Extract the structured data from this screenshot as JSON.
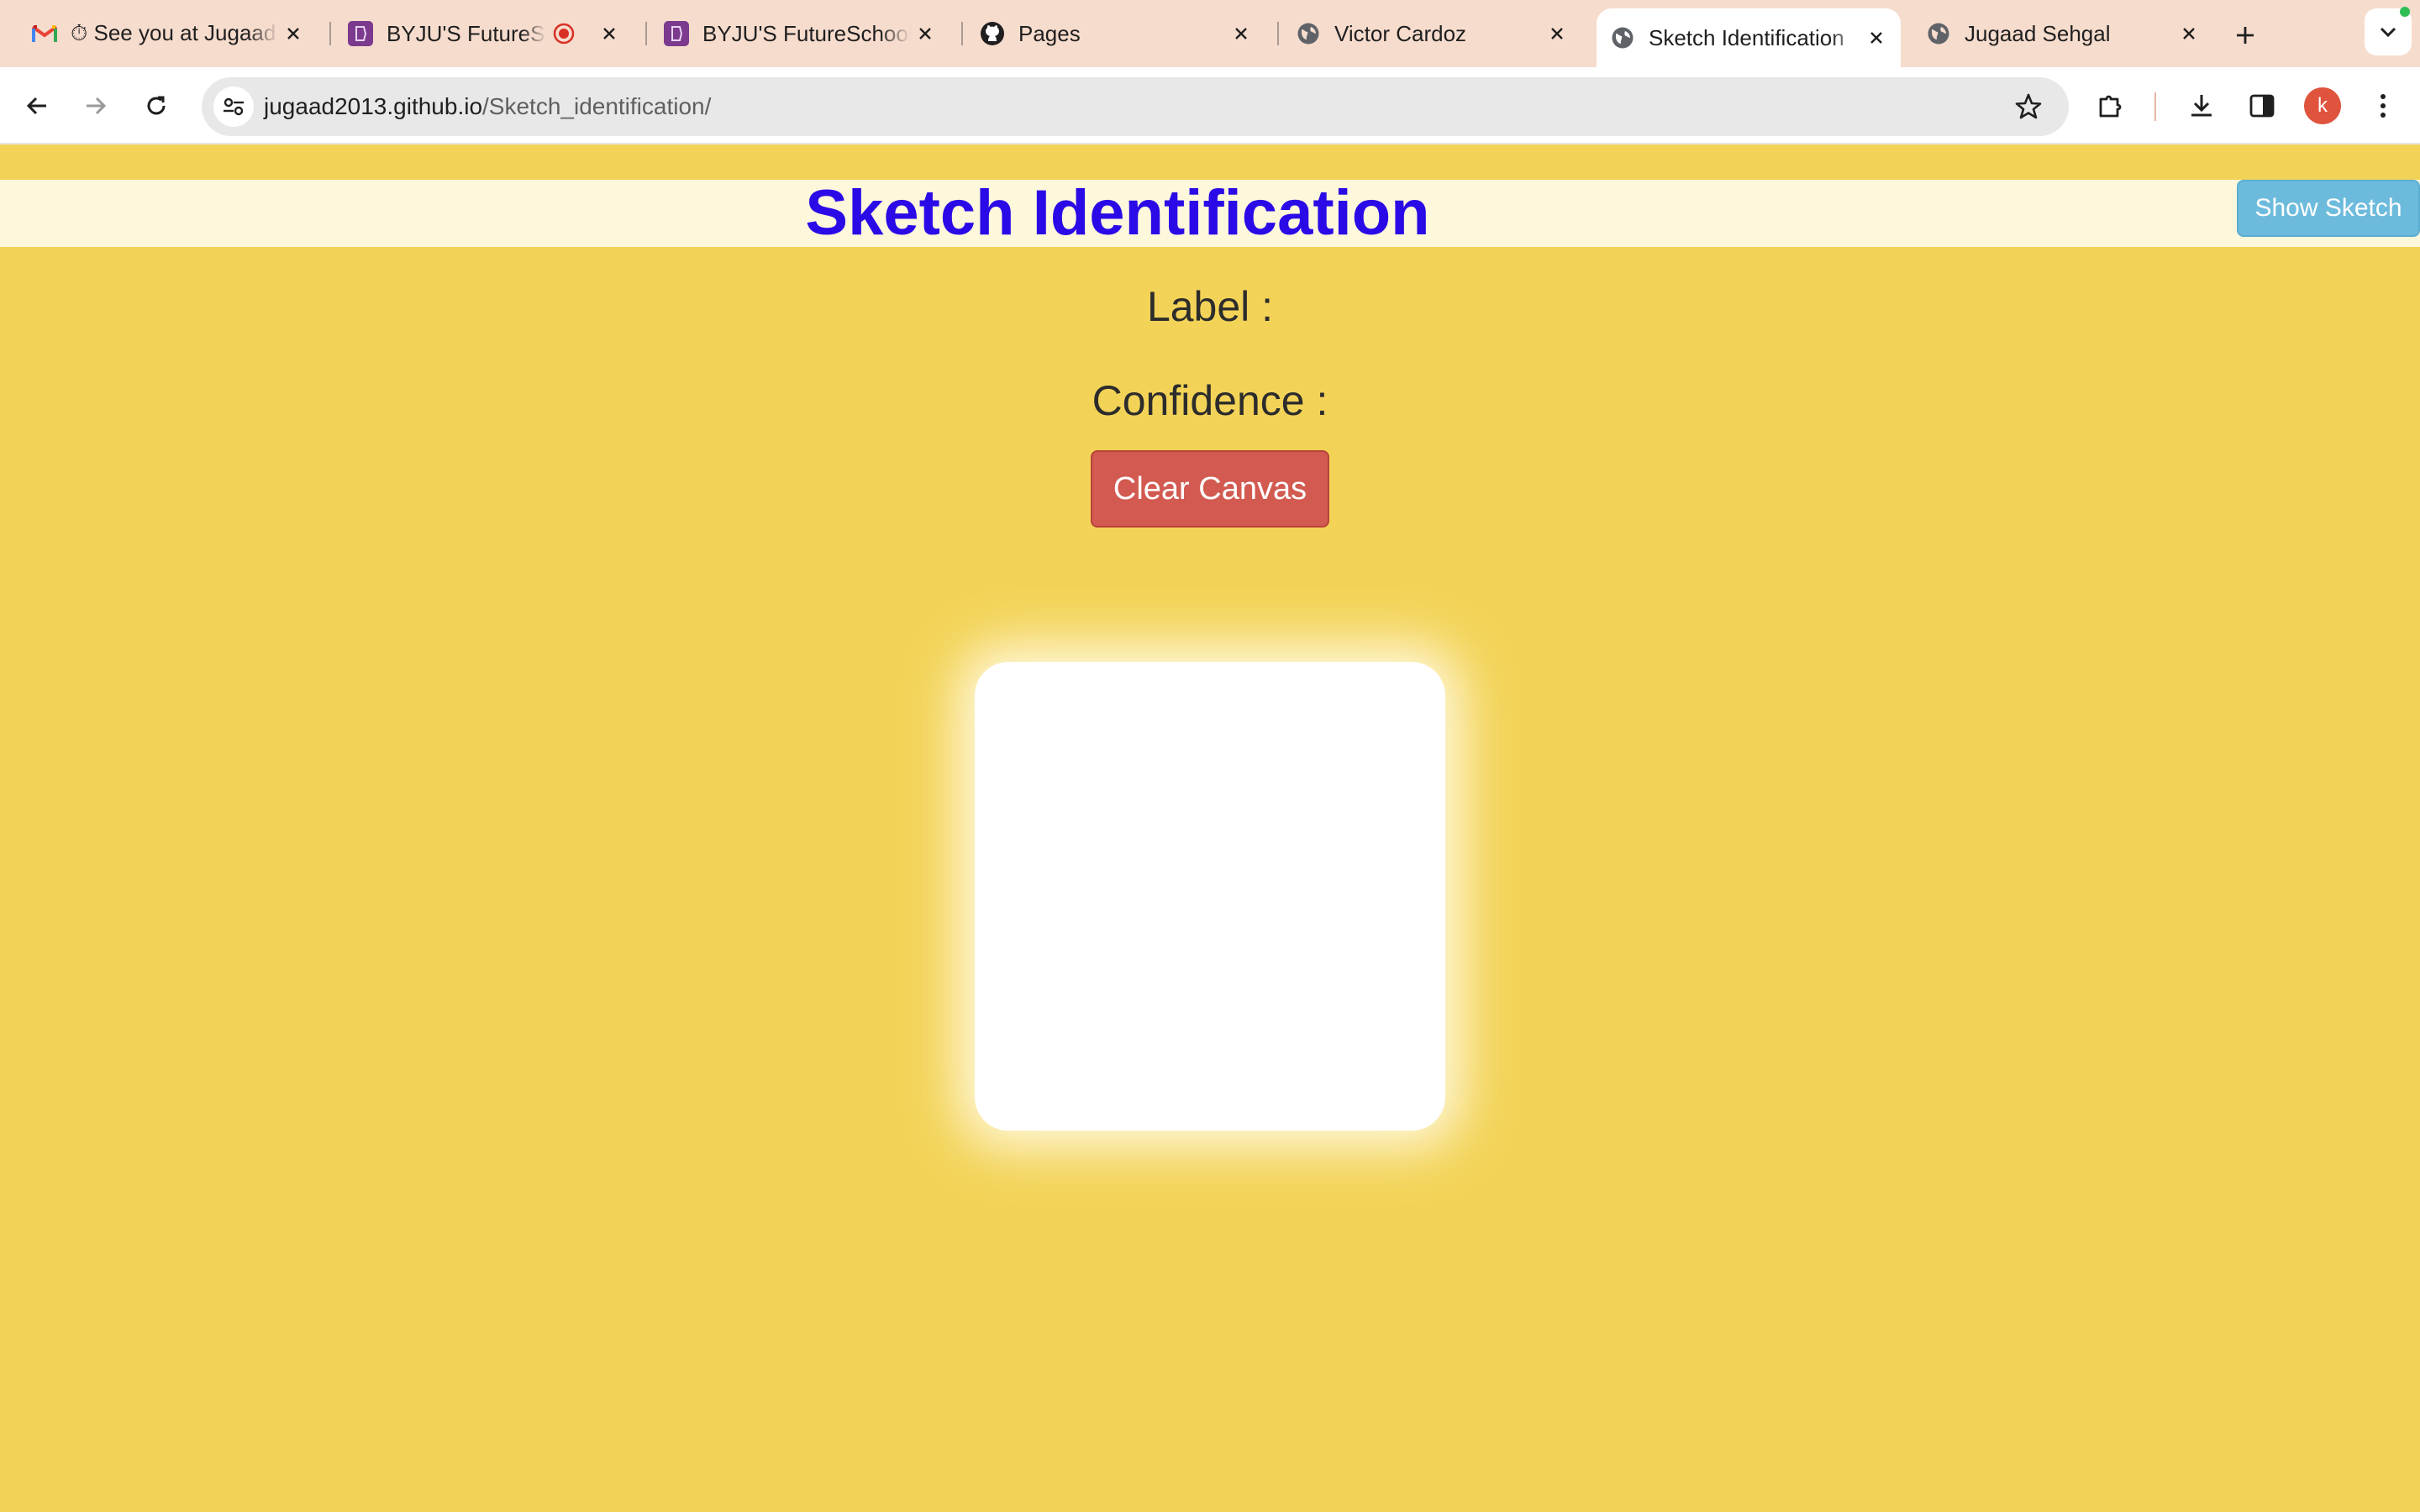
{
  "browser": {
    "tabs": [
      {
        "title": "⏱ See you at Jugaad",
        "icon": "gmail-icon"
      },
      {
        "title": "BYJU'S FutureSchool",
        "icon": "byjus-icon",
        "recording": true
      },
      {
        "title": "BYJU'S FutureSchool",
        "icon": "byjus-icon"
      },
      {
        "title": "Pages",
        "icon": "github-icon"
      },
      {
        "title": "Victor Cardoz",
        "icon": "globe-icon"
      },
      {
        "title": "Sketch Identification",
        "icon": "globe-icon",
        "active": true
      },
      {
        "title": "Jugaad Sehgal",
        "icon": "globe-icon"
      }
    ],
    "url_host": "jugaad2013.github.io",
    "url_path": "/Sketch_identification/",
    "profile_initial": "k"
  },
  "page": {
    "title": "Sketch Identification",
    "show_sketch_label": "Show Sketch",
    "label_text": "Label :",
    "confidence_text": "Confidence :",
    "clear_canvas_label": "Clear Canvas"
  },
  "colors": {
    "background": "#f3d357",
    "header_band": "#fdf7dc",
    "title": "#2a0ae6",
    "show_sketch_button": "#6dbbdc",
    "clear_button": "#d25a50",
    "canvas": "#ffffff"
  }
}
